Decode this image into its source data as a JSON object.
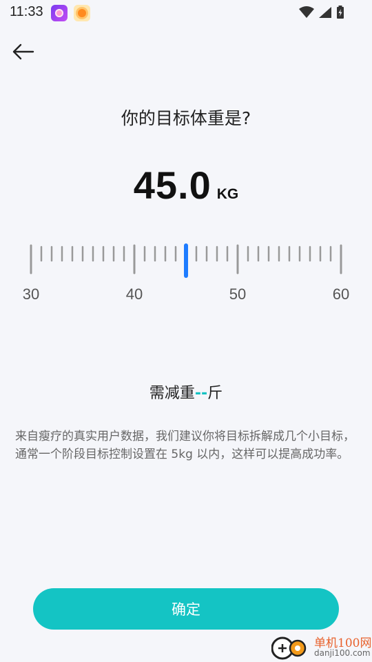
{
  "status_bar": {
    "time": "11:33",
    "icons": [
      "podcast-app-icon",
      "sun-app-icon",
      "wifi-icon",
      "signal-icon",
      "battery-charging-icon"
    ]
  },
  "header": {
    "back_icon": "arrow-left-icon"
  },
  "question": "你的目标体重是?",
  "weight": {
    "value": "45.0",
    "unit": "KG"
  },
  "ruler": {
    "labels": [
      "30",
      "40",
      "50",
      "60"
    ],
    "min": 30,
    "max": 60,
    "selected": 45.0,
    "accent_color": "#1e7cff"
  },
  "need_loss": {
    "prefix": "需减重",
    "value": "--",
    "suffix": "斤"
  },
  "advice": "来自瘦疗的真实用户数据，我们建议你将目标拆解成几个小目标，通常一个阶段目标控制设置在 5kg 以内，这样可以提高成功率。",
  "confirm_label": "确定",
  "colors": {
    "primary": "#14c4c4",
    "background": "#f5f6fa"
  },
  "watermark": {
    "title": "单机100网",
    "url": "danji100.com"
  }
}
